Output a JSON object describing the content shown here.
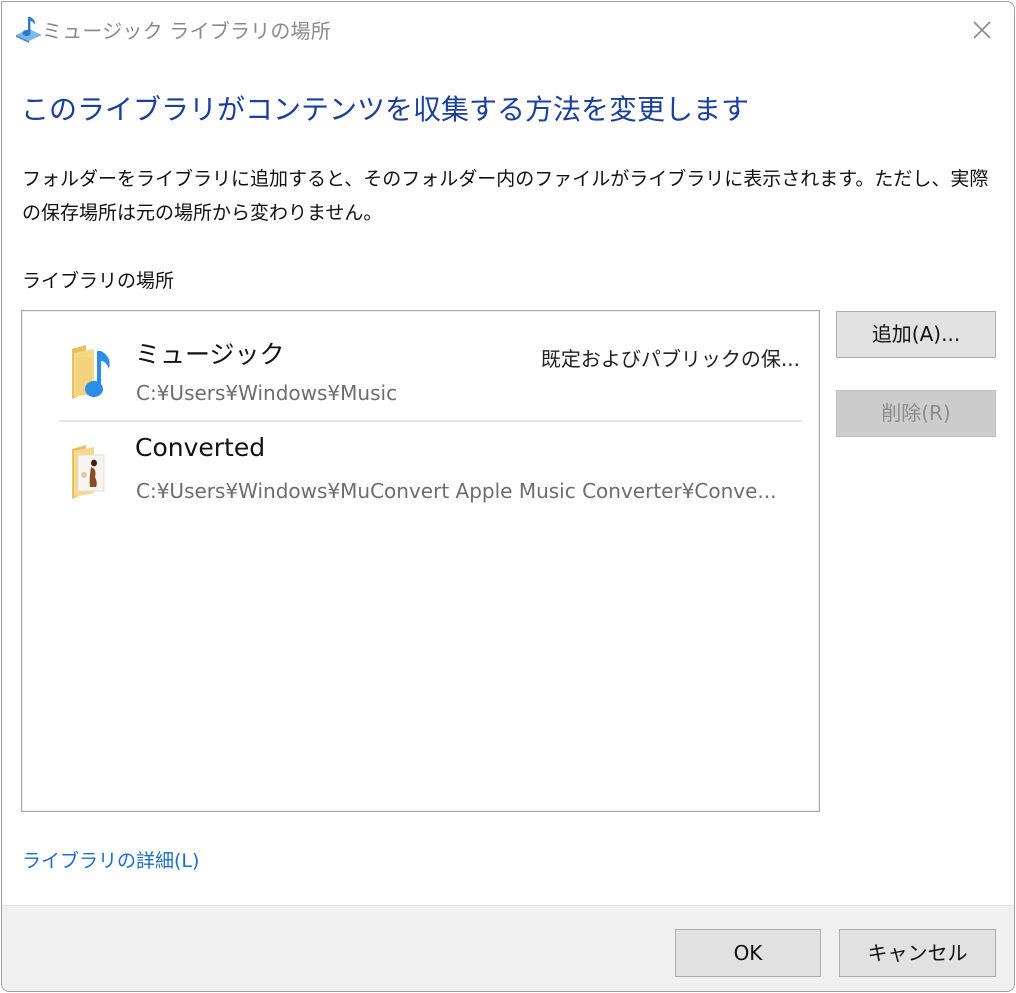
{
  "window": {
    "title": "ミュージック ライブラリの場所",
    "title_icon": "music-library-icon",
    "close_icon": "close-icon"
  },
  "main": {
    "heading": "このライブラリがコンテンツを収集する方法を変更します",
    "description": "フォルダーをライブラリに追加すると、そのフォルダー内のファイルがライブラリに表示されます。ただし、実際の保存場所は元の場所から変わりません。",
    "section_label": "ライブラリの場所"
  },
  "locations": [
    {
      "name": "ミュージック",
      "path": "C:¥Users¥Windows¥Music",
      "status": "既定およびパブリックの保...",
      "icon": "music-folder-icon"
    },
    {
      "name": "Converted",
      "path": "C:¥Users¥Windows¥MuConvert Apple Music Converter¥Conve...",
      "status": "",
      "icon": "album-art-folder-icon"
    }
  ],
  "side_buttons": {
    "add_label": "追加(A)...",
    "remove_label": "削除(R)",
    "remove_disabled": true
  },
  "link": {
    "label": "ライブラリの詳細(L)"
  },
  "footer": {
    "ok_label": "OK",
    "cancel_label": "キャンセル"
  },
  "colors": {
    "heading": "#1b3f9c",
    "link": "#1a6ec8",
    "footer_bg": "#f0f0f0",
    "button_bg": "#e1e1e1",
    "button_disabled_bg": "#cccccc"
  }
}
